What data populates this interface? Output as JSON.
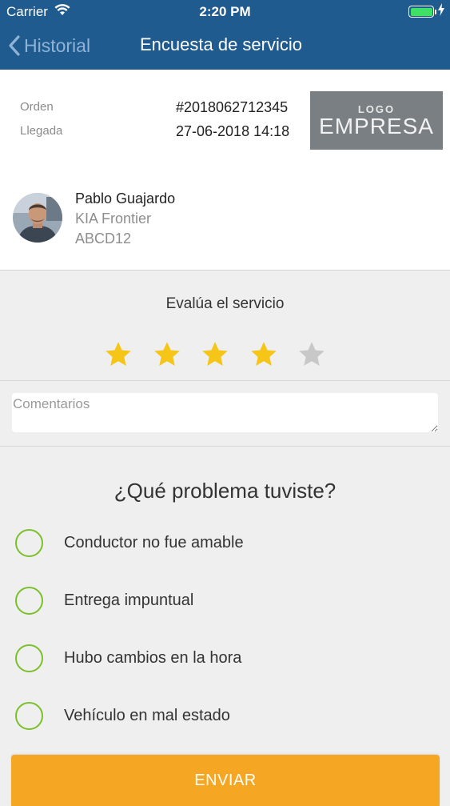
{
  "status_bar": {
    "carrier": "Carrier",
    "time": "2:20 PM",
    "battery_color": "#3ee066"
  },
  "nav": {
    "back_label": "Historial",
    "title": "Encuesta de servicio",
    "bar_color": "#1f5b8e"
  },
  "order": {
    "order_label": "Orden",
    "order_value": "#2018062712345",
    "arrival_label": "Llegada",
    "arrival_value": "27-06-2018 14:18",
    "logo_top": "LOGO",
    "logo_bottom": "EMPRESA"
  },
  "driver": {
    "name": "Pablo Guajardo",
    "vehicle": "KIA Frontier",
    "plate": "ABCD12"
  },
  "rating": {
    "title": "Evalúa el servicio",
    "value": 4,
    "max": 5,
    "filled_color": "#f5c518",
    "empty_color": "#c8c8c8"
  },
  "comments": {
    "placeholder": "Comentarios",
    "value": ""
  },
  "problems": {
    "title": "¿Qué problema tuviste?",
    "options": [
      {
        "label": "Conductor no fue amable",
        "selected": false
      },
      {
        "label": "Entrega impuntual",
        "selected": false
      },
      {
        "label": "Hubo cambios en la hora",
        "selected": false
      },
      {
        "label": "Vehículo en mal estado",
        "selected": false
      }
    ],
    "radio_color": "#7cbf2a"
  },
  "submit": {
    "label": "ENVIAR",
    "color": "#f5a623"
  }
}
